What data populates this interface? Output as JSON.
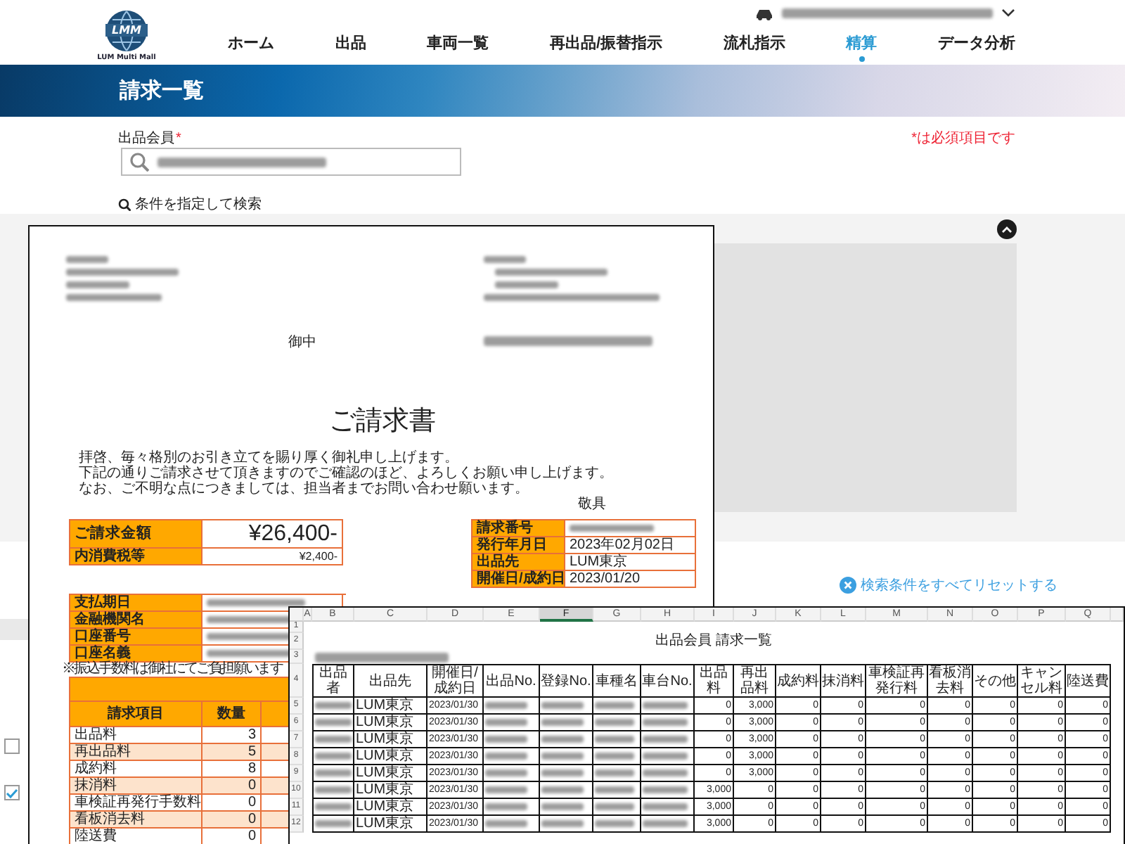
{
  "header": {
    "logo": {
      "mark": "LMM",
      "name": "LUM Multi Mall"
    },
    "user": {
      "kind": "redacted"
    },
    "nav": [
      {
        "label": "ホーム",
        "selected": false
      },
      {
        "label": "出品",
        "selected": false
      },
      {
        "label": "車両一覧",
        "selected": false
      },
      {
        "label": "再出品/振替指示",
        "selected": false
      },
      {
        "label": "流札指示",
        "selected": false
      },
      {
        "label": "精算",
        "selected": true
      },
      {
        "label": "データ分析",
        "selected": false
      }
    ]
  },
  "banner": {
    "title": "請求一覧"
  },
  "search": {
    "label": "出品会員",
    "required_mark": "*",
    "required_note": "*は必須項目です",
    "value": {
      "kind": "redacted"
    },
    "toggle_label": "条件を指定して検索",
    "reset_label": "検索条件をすべてリセットする"
  },
  "results": {
    "rows": [
      {
        "checked": false
      },
      {
        "checked": true
      }
    ]
  },
  "invoice": {
    "recipient_lines": [
      {
        "kind": "redacted"
      },
      {
        "kind": "redacted"
      },
      {
        "kind": "redacted"
      },
      {
        "kind": "redacted"
      }
    ],
    "honorific": "御中",
    "sender_lines": [
      {
        "kind": "redacted"
      },
      {
        "kind": "redacted"
      },
      {
        "kind": "redacted"
      },
      {
        "kind": "redacted"
      }
    ],
    "sender_company": {
      "kind": "redacted"
    },
    "title": "ご請求書",
    "greeting": [
      "拝啓、毎々格別のお引き立てを賜り厚く御礼申し上げます。",
      "下記の通りご請求させて頂きますのでご確認のほど、よろしくお願い申し上げます。",
      "なお、ご不明な点につきましては、担当者までお問い合わせ願います。"
    ],
    "closing": "敬具",
    "amount": [
      {
        "kind": "total",
        "label": "ご請求金額",
        "value": "¥26,400-"
      },
      {
        "kind": "tax",
        "label": "内消費税等",
        "value": "¥2,400-"
      }
    ],
    "details": [
      {
        "kind": "redacted",
        "label": "請求番号"
      },
      {
        "kind": "text",
        "label": "発行年月日",
        "value": "2023年02月02日"
      },
      {
        "kind": "text",
        "label": "出品先",
        "value": "LUM東京"
      },
      {
        "kind": "text",
        "label": "開催日/成約日",
        "value": "2023/01/20"
      }
    ],
    "bank": [
      {
        "kind": "redacted",
        "label": "支払期日"
      },
      {
        "kind": "redacted",
        "label": "金融機関名"
      },
      {
        "kind": "redacted",
        "label": "口座番号"
      },
      {
        "kind": "redacted",
        "label": "口座名義"
      }
    ],
    "fee_note": "※振込手数料は御社にてご負担願います",
    "item_columns": [
      "請求項目",
      "数量"
    ],
    "items": [
      {
        "name": "出品料",
        "quantity": "3"
      },
      {
        "name": "再出品料",
        "quantity": "5"
      },
      {
        "name": "成約料",
        "quantity": "8"
      },
      {
        "name": "抹消料",
        "quantity": "0"
      },
      {
        "name": "車検証再発行手数料",
        "quantity": "0"
      },
      {
        "name": "看板消去料",
        "quantity": "0"
      },
      {
        "name": "陸送費",
        "quantity": "0"
      }
    ]
  },
  "spreadsheet": {
    "column_letters": [
      {
        "label": "A",
        "selected": false
      },
      {
        "label": "B",
        "selected": false
      },
      {
        "label": "C",
        "selected": false
      },
      {
        "label": "D",
        "selected": false
      },
      {
        "label": "E",
        "selected": false
      },
      {
        "label": "F",
        "selected": true
      },
      {
        "label": "G",
        "selected": false
      },
      {
        "label": "H",
        "selected": false
      },
      {
        "label": "I",
        "selected": false
      },
      {
        "label": "J",
        "selected": false
      },
      {
        "label": "K",
        "selected": false
      },
      {
        "label": "L",
        "selected": false
      },
      {
        "label": "M",
        "selected": false
      },
      {
        "label": "N",
        "selected": false
      },
      {
        "label": "O",
        "selected": false
      },
      {
        "label": "P",
        "selected": false
      },
      {
        "label": "Q",
        "selected": false
      }
    ],
    "top_row_numbers": [
      "1",
      "2",
      "3",
      "4"
    ],
    "title": "出品会員 請求一覧",
    "subtitle": {
      "kind": "redacted"
    },
    "columns": [
      "出品者",
      "出品先",
      "開催日/成約日",
      "出品No.",
      "登録No.",
      "車種名",
      "車台No.",
      "出品料",
      "再出品料",
      "成約料",
      "抹消料",
      "車検証再発行料",
      "看板消去料",
      "その他",
      "キャンセル料",
      "陸送費"
    ],
    "rows": [
      {
        "number": "5",
        "cells": [
          {
            "kind": "redacted"
          },
          {
            "kind": "text",
            "text": "LUM東京"
          },
          {
            "kind": "text",
            "text": "2023/01/30"
          },
          {
            "kind": "redacted"
          },
          {
            "kind": "redacted"
          },
          {
            "kind": "redacted"
          },
          {
            "kind": "redacted"
          },
          {
            "kind": "number",
            "text": "0"
          },
          {
            "kind": "number",
            "text": "3,000"
          },
          {
            "kind": "number",
            "text": "0"
          },
          {
            "kind": "number",
            "text": "0"
          },
          {
            "kind": "number",
            "text": "0"
          },
          {
            "kind": "number",
            "text": "0"
          },
          {
            "kind": "number",
            "text": "0"
          },
          {
            "kind": "number",
            "text": "0"
          },
          {
            "kind": "number",
            "text": "0"
          }
        ]
      },
      {
        "number": "6",
        "cells": [
          {
            "kind": "redacted"
          },
          {
            "kind": "text",
            "text": "LUM東京"
          },
          {
            "kind": "text",
            "text": "2023/01/30"
          },
          {
            "kind": "redacted"
          },
          {
            "kind": "redacted"
          },
          {
            "kind": "redacted"
          },
          {
            "kind": "redacted"
          },
          {
            "kind": "number",
            "text": "0"
          },
          {
            "kind": "number",
            "text": "3,000"
          },
          {
            "kind": "number",
            "text": "0"
          },
          {
            "kind": "number",
            "text": "0"
          },
          {
            "kind": "number",
            "text": "0"
          },
          {
            "kind": "number",
            "text": "0"
          },
          {
            "kind": "number",
            "text": "0"
          },
          {
            "kind": "number",
            "text": "0"
          },
          {
            "kind": "number",
            "text": "0"
          }
        ]
      },
      {
        "number": "7",
        "cells": [
          {
            "kind": "redacted"
          },
          {
            "kind": "text",
            "text": "LUM東京"
          },
          {
            "kind": "text",
            "text": "2023/01/30"
          },
          {
            "kind": "redacted"
          },
          {
            "kind": "redacted"
          },
          {
            "kind": "redacted"
          },
          {
            "kind": "redacted"
          },
          {
            "kind": "number",
            "text": "0"
          },
          {
            "kind": "number",
            "text": "3,000"
          },
          {
            "kind": "number",
            "text": "0"
          },
          {
            "kind": "number",
            "text": "0"
          },
          {
            "kind": "number",
            "text": "0"
          },
          {
            "kind": "number",
            "text": "0"
          },
          {
            "kind": "number",
            "text": "0"
          },
          {
            "kind": "number",
            "text": "0"
          },
          {
            "kind": "number",
            "text": "0"
          }
        ]
      },
      {
        "number": "8",
        "cells": [
          {
            "kind": "redacted"
          },
          {
            "kind": "text",
            "text": "LUM東京"
          },
          {
            "kind": "text",
            "text": "2023/01/30"
          },
          {
            "kind": "redacted"
          },
          {
            "kind": "redacted"
          },
          {
            "kind": "redacted"
          },
          {
            "kind": "redacted"
          },
          {
            "kind": "number",
            "text": "0"
          },
          {
            "kind": "number",
            "text": "3,000"
          },
          {
            "kind": "number",
            "text": "0"
          },
          {
            "kind": "number",
            "text": "0"
          },
          {
            "kind": "number",
            "text": "0"
          },
          {
            "kind": "number",
            "text": "0"
          },
          {
            "kind": "number",
            "text": "0"
          },
          {
            "kind": "number",
            "text": "0"
          },
          {
            "kind": "number",
            "text": "0"
          }
        ]
      },
      {
        "number": "9",
        "cells": [
          {
            "kind": "redacted"
          },
          {
            "kind": "text",
            "text": "LUM東京"
          },
          {
            "kind": "text",
            "text": "2023/01/30"
          },
          {
            "kind": "redacted"
          },
          {
            "kind": "redacted"
          },
          {
            "kind": "redacted"
          },
          {
            "kind": "redacted"
          },
          {
            "kind": "number",
            "text": "0"
          },
          {
            "kind": "number",
            "text": "3,000"
          },
          {
            "kind": "number",
            "text": "0"
          },
          {
            "kind": "number",
            "text": "0"
          },
          {
            "kind": "number",
            "text": "0"
          },
          {
            "kind": "number",
            "text": "0"
          },
          {
            "kind": "number",
            "text": "0"
          },
          {
            "kind": "number",
            "text": "0"
          },
          {
            "kind": "number",
            "text": "0"
          }
        ]
      },
      {
        "number": "10",
        "cells": [
          {
            "kind": "redacted"
          },
          {
            "kind": "text",
            "text": "LUM東京"
          },
          {
            "kind": "text",
            "text": "2023/01/30"
          },
          {
            "kind": "redacted"
          },
          {
            "kind": "redacted"
          },
          {
            "kind": "redacted"
          },
          {
            "kind": "redacted"
          },
          {
            "kind": "number",
            "text": "3,000"
          },
          {
            "kind": "number",
            "text": "0"
          },
          {
            "kind": "number",
            "text": "0"
          },
          {
            "kind": "number",
            "text": "0"
          },
          {
            "kind": "number",
            "text": "0"
          },
          {
            "kind": "number",
            "text": "0"
          },
          {
            "kind": "number",
            "text": "0"
          },
          {
            "kind": "number",
            "text": "0"
          },
          {
            "kind": "number",
            "text": "0"
          }
        ]
      },
      {
        "number": "11",
        "cells": [
          {
            "kind": "redacted"
          },
          {
            "kind": "text",
            "text": "LUM東京"
          },
          {
            "kind": "text",
            "text": "2023/01/30"
          },
          {
            "kind": "redacted"
          },
          {
            "kind": "redacted"
          },
          {
            "kind": "redacted"
          },
          {
            "kind": "redacted"
          },
          {
            "kind": "number",
            "text": "3,000"
          },
          {
            "kind": "number",
            "text": "0"
          },
          {
            "kind": "number",
            "text": "0"
          },
          {
            "kind": "number",
            "text": "0"
          },
          {
            "kind": "number",
            "text": "0"
          },
          {
            "kind": "number",
            "text": "0"
          },
          {
            "kind": "number",
            "text": "0"
          },
          {
            "kind": "number",
            "text": "0"
          },
          {
            "kind": "number",
            "text": "0"
          }
        ]
      },
      {
        "number": "12",
        "cells": [
          {
            "kind": "redacted"
          },
          {
            "kind": "text",
            "text": "LUM東京"
          },
          {
            "kind": "text",
            "text": "2023/01/30"
          },
          {
            "kind": "redacted"
          },
          {
            "kind": "redacted"
          },
          {
            "kind": "redacted"
          },
          {
            "kind": "redacted"
          },
          {
            "kind": "number",
            "text": "3,000"
          },
          {
            "kind": "number",
            "text": "0"
          },
          {
            "kind": "number",
            "text": "0"
          },
          {
            "kind": "number",
            "text": "0"
          },
          {
            "kind": "number",
            "text": "0"
          },
          {
            "kind": "number",
            "text": "0"
          },
          {
            "kind": "number",
            "text": "0"
          },
          {
            "kind": "number",
            "text": "0"
          },
          {
            "kind": "number",
            "text": "0"
          }
        ]
      }
    ]
  }
}
